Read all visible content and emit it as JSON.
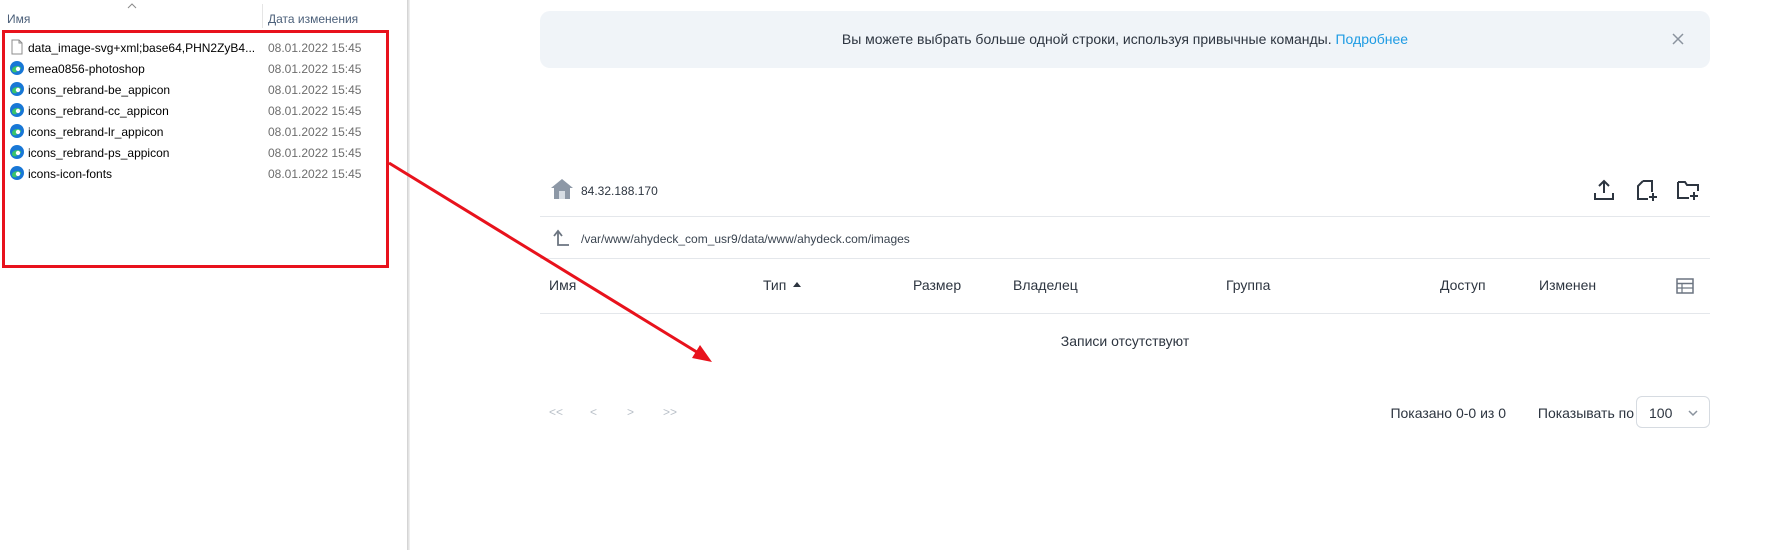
{
  "explorer": {
    "columns": {
      "name": "Имя",
      "date": "Дата изменения"
    },
    "files": [
      {
        "name": "data_image-svg+xml;base64,PHN2ZyB4...",
        "date": "08.01.2022 15:45",
        "icon": "blank-file-icon"
      },
      {
        "name": "emea0856-photoshop",
        "date": "08.01.2022 15:45",
        "icon": "edge-browser-icon"
      },
      {
        "name": "icons_rebrand-be_appicon",
        "date": "08.01.2022 15:45",
        "icon": "edge-browser-icon"
      },
      {
        "name": "icons_rebrand-cc_appicon",
        "date": "08.01.2022 15:45",
        "icon": "edge-browser-icon"
      },
      {
        "name": "icons_rebrand-lr_appicon",
        "date": "08.01.2022 15:45",
        "icon": "edge-browser-icon"
      },
      {
        "name": "icons_rebrand-ps_appicon",
        "date": "08.01.2022 15:45",
        "icon": "edge-browser-icon"
      },
      {
        "name": "icons-icon-fonts",
        "date": "08.01.2022 15:45",
        "icon": "edge-browser-icon"
      }
    ]
  },
  "banner": {
    "text": "Вы можете выбрать больше одной строки, используя привычные команды.",
    "link": "Подробнее"
  },
  "host": {
    "address": "84.32.188.170"
  },
  "path": {
    "value": "/var/www/ahydeck_com_usr9/data/www/ahydeck.com/images"
  },
  "table": {
    "headers": {
      "name": "Имя",
      "type": "Тип",
      "size": "Размер",
      "owner": "Владелец",
      "group": "Группа",
      "access": "Доступ",
      "modified": "Изменен"
    },
    "empty": "Записи отсутствуют"
  },
  "pager": {
    "first": "<<",
    "prev": "<",
    "next": ">",
    "last": ">>",
    "shown": "Показано 0-0 из 0",
    "perpage_label": "Показывать по",
    "perpage_value": "100"
  },
  "colors": {
    "annotation": "#e8121c",
    "link": "#1e9be3",
    "banner_bg": "#f0f4f8",
    "edge_blue": "#1877d6",
    "edge_green": "#3ac46b"
  }
}
